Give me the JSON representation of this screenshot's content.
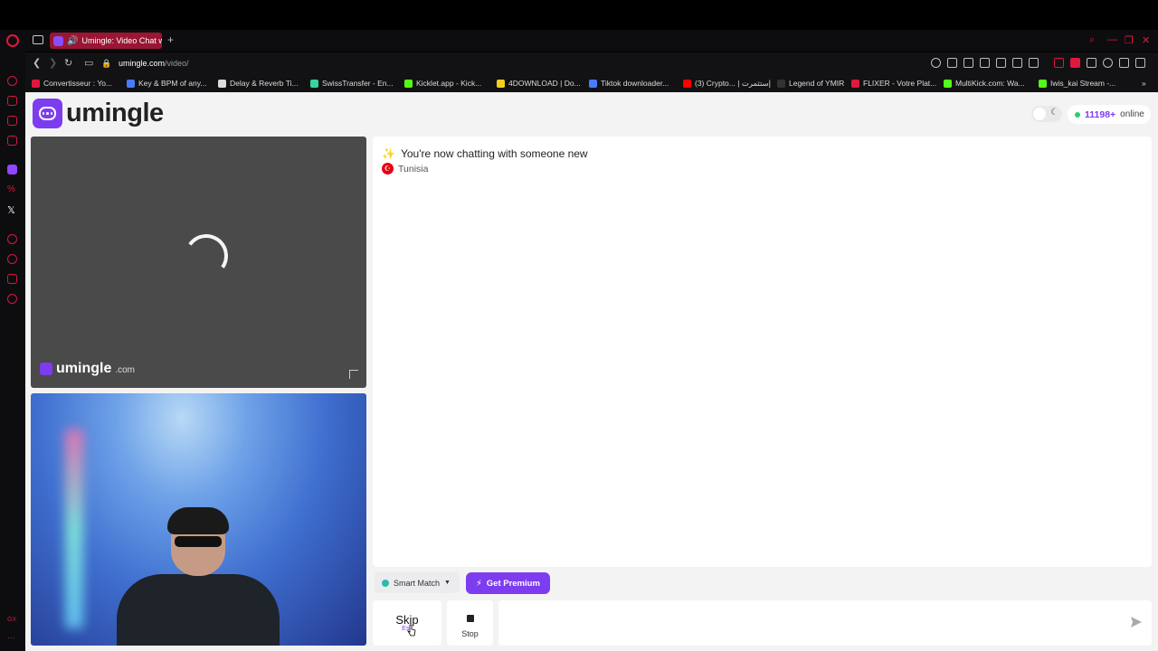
{
  "browser": {
    "tab_title": "Umingle: Video Chat wi",
    "new_tab_symbol": "+",
    "url_host": "umingle.com",
    "url_path": "/video/",
    "bookmarks": [
      {
        "label": "Convertisseur : Yo...",
        "color": "#e0183d"
      },
      {
        "label": "Key & BPM of any...",
        "color": "#4a7bff"
      },
      {
        "label": "Delay & Reverb Ti...",
        "color": "#dddddd"
      },
      {
        "label": "SwissTransfer - En...",
        "color": "#38d39f"
      },
      {
        "label": "Kicklet.app - Kick...",
        "color": "#53fc18"
      },
      {
        "label": "4DOWNLOAD | Do...",
        "color": "#f5d020"
      },
      {
        "label": "Tiktok downloader...",
        "color": "#4a7bff"
      },
      {
        "label": "(3) Crypto... | إستثمرت",
        "color": "#ff0000"
      },
      {
        "label": "Legend of YMIR",
        "color": "#333333"
      },
      {
        "label": "FLIXER - Votre Plat...",
        "color": "#e0183d"
      },
      {
        "label": "MultiKick.com: Wa...",
        "color": "#53fc18"
      },
      {
        "label": "Iwis_kai Stream -...",
        "color": "#53fc18"
      }
    ]
  },
  "header": {
    "logo_text": "umingle",
    "online_count": "11198+",
    "online_label": "online",
    "theme_icon": "moon-icon"
  },
  "remote_video": {
    "watermark_brand": "umingle",
    "watermark_domain": ".com"
  },
  "chat": {
    "status_message": "You're now chatting with someone new",
    "status_icon": "✨",
    "partner_country": "Tunisia"
  },
  "controls": {
    "smart_match_label": "Smart Match",
    "premium_label": "Get Premium",
    "skip_label": "Skip",
    "skip_hint": "Esc",
    "stop_label": "Stop",
    "message_placeholder": ""
  },
  "colors": {
    "accent": "#7d3cf0",
    "browser_red": "#e0183d",
    "online_green": "#2ecc71"
  }
}
